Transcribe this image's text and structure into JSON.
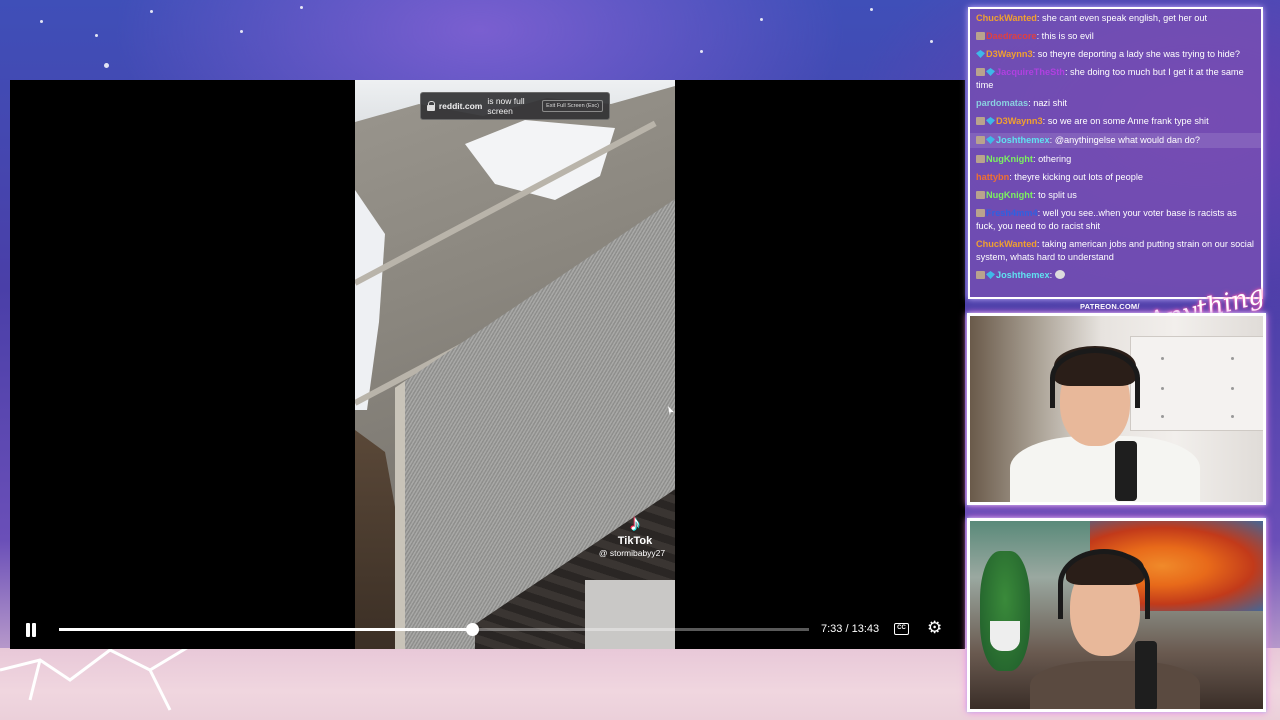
{
  "player": {
    "fullscreen_banner": {
      "domain": "reddit.com",
      "message": "is now full screen",
      "exit_hint": "Exit Full Screen (Esc)"
    },
    "watermark": {
      "brand": "TikTok",
      "handle": "@ stormibabyy27"
    },
    "time_display": "7:33 / 13:43",
    "progress_fraction": 0.55,
    "cc_label": "CC",
    "icons": {
      "pause": "pause-icon",
      "captions": "closed-captions-icon",
      "settings": "gear-icon"
    }
  },
  "chat": {
    "messages": [
      {
        "user": "ChuckWanted",
        "text": "she cant even speak english, get her out",
        "color": "#f0a030",
        "badges": [],
        "highlight": false
      },
      {
        "user": "Daedracore",
        "text": "this is so evil",
        "color": "#e04040",
        "badges": [
          "a"
        ],
        "highlight": false
      },
      {
        "user": "D3Waynn3",
        "text": "so theyre deporting a lady she was trying to hide?",
        "color": "#f0a030",
        "badges": [
          "b"
        ],
        "highlight": false
      },
      {
        "user": "JacquireTheSth",
        "text": "she doing too much but I get it at the same time",
        "color": "#b040e0",
        "badges": [
          "a",
          "b"
        ],
        "highlight": false
      },
      {
        "user": "pardomatas",
        "text": "nazi shit",
        "color": "#8ad0e0",
        "badges": [],
        "highlight": false
      },
      {
        "user": "D3Waynn3",
        "text": "so we are on some Anne frank type shit",
        "color": "#f0a030",
        "badges": [
          "a",
          "b"
        ],
        "highlight": false
      },
      {
        "user": "Joshthemex",
        "text": "@anythingelse what would dan do?",
        "color": "#60e0f0",
        "badges": [
          "a",
          "b"
        ],
        "highlight": true
      },
      {
        "user": "NugKnight",
        "text": "othering",
        "color": "#7cf060",
        "badges": [
          "a"
        ],
        "highlight": false
      },
      {
        "user": "hattybn",
        "text": "theyre kicking out lots of people",
        "color": "#f07030",
        "badges": [],
        "highlight": false
      },
      {
        "user": "NugKnight",
        "text": "to split us",
        "color": "#7cf060",
        "badges": [
          "a"
        ],
        "highlight": false
      },
      {
        "user": "Fresh4mm4",
        "text": "well you see..when your voter base is racists as fuck, you need to do racist shit",
        "color": "#3060e0",
        "badges": [
          "a"
        ],
        "highlight": false
      },
      {
        "user": "ChuckWanted",
        "text": "taking american jobs and putting strain on our social system, whats hard to understand",
        "color": "#f0a030",
        "badges": [],
        "highlight": false
      },
      {
        "user": "Joshthemex",
        "text": "",
        "color": "#60e0f0",
        "badges": [
          "a",
          "b"
        ],
        "highlight": false,
        "emote": true
      }
    ]
  },
  "overlay": {
    "patreon": "PATREON.COM/",
    "signature": "Anything Else?"
  },
  "colors": {
    "chat_border": "#ffffff",
    "cam_glow": "#ff7ae0",
    "chat_bg": "#7850b4"
  }
}
